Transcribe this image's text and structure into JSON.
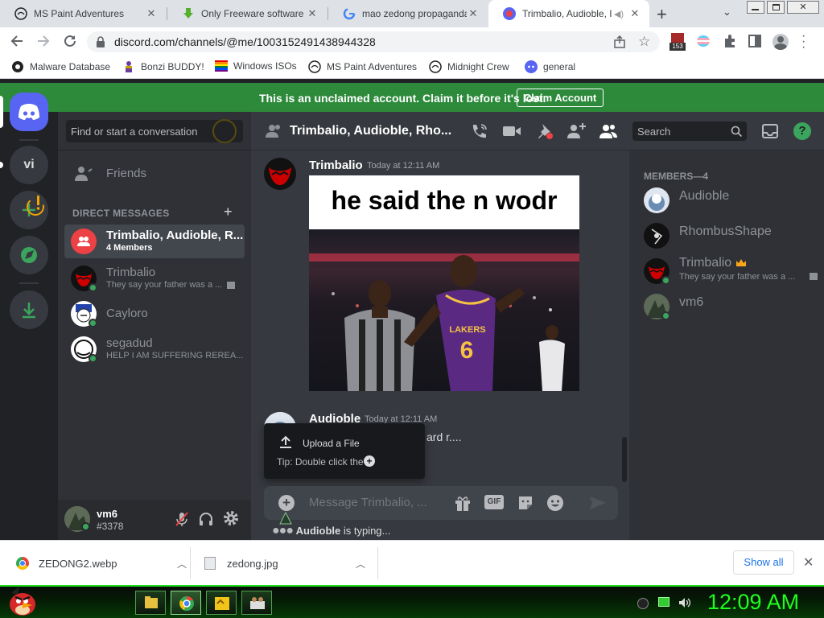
{
  "browser": {
    "tabs": [
      {
        "title": "MS Paint Adventures",
        "icon": "mspa-tab-icon"
      },
      {
        "title": "Only Freeware software f",
        "icon": "download-tab-icon"
      },
      {
        "title": "mao zedong propaganda",
        "icon": "google-tab-icon"
      },
      {
        "title": "Trimbalio, Audioble, I",
        "icon": "discord-tab-icon",
        "active": true
      }
    ],
    "new_tab": "+",
    "url": "discord.com/channels/@me/1003152491438944328",
    "extension_badge": "153",
    "bookmarks": [
      {
        "label": "Malware Database"
      },
      {
        "label": "Bonzi BUDDY!"
      },
      {
        "label": "Windows ISOs"
      },
      {
        "label": "MS Paint Adventures"
      },
      {
        "label": "Midnight Crew"
      },
      {
        "label": "general"
      }
    ]
  },
  "banner": {
    "message": "This is an unclaimed account. Claim it before it's lost.",
    "button": "Claim Account"
  },
  "servers": {
    "vi_label": "vi"
  },
  "dm": {
    "search_placeholder": "Find or start a conversation",
    "friends": "Friends",
    "section": "DIRECT MESSAGES",
    "add": "+",
    "items": [
      {
        "name": "Trimbalio, Audioble, R...",
        "sub": "4 Members",
        "selected": true
      },
      {
        "name": "Trimbalio",
        "sub": "They say your father was a ..."
      },
      {
        "name": "Cayloro",
        "sub": ""
      },
      {
        "name": "segadud",
        "sub": "HELP I AM SUFFERING REREA..."
      }
    ]
  },
  "user": {
    "name": "vm6",
    "tag": "#3378"
  },
  "chat": {
    "header_title": "Trimbalio, Audioble, Rho...",
    "search_placeholder": "Search",
    "messages": [
      {
        "author": "Trimbalio",
        "time": "Today at 12:11 AM",
        "caption": "he said the n wodr",
        "jersey": "6",
        "jersey_team": "LAKERS"
      },
      {
        "author": "Audioble",
        "time": "Today at 12:11 AM",
        "text_fragment": "ard r...."
      }
    ],
    "upload_popup": {
      "title": "Upload a File",
      "tip": "Tip: Double click the"
    },
    "input_placeholder": "Message Trimbalio, ...",
    "gif_label": "GIF",
    "typing_user": "Audioble",
    "typing_suffix": " is typing..."
  },
  "members": {
    "header": "MEMBERS—4",
    "items": [
      {
        "name": "Audioble",
        "sub": ""
      },
      {
        "name": "RhombusShape",
        "sub": ""
      },
      {
        "name": "Trimbalio",
        "sub": "They say your father was a ...",
        "owner": true
      },
      {
        "name": "vm6",
        "sub": ""
      }
    ]
  },
  "downloads": {
    "items": [
      {
        "name": "ZEDONG2.webp"
      },
      {
        "name": "zedong.jpg"
      }
    ],
    "show_all": "Show all"
  },
  "taskbar": {
    "clock": "12:09 AM"
  },
  "colors": {
    "discord_blurple": "#5865f2",
    "banner_green": "#2d8a3b",
    "online_green": "#3ba55d",
    "clock_green": "#1dff1d"
  }
}
